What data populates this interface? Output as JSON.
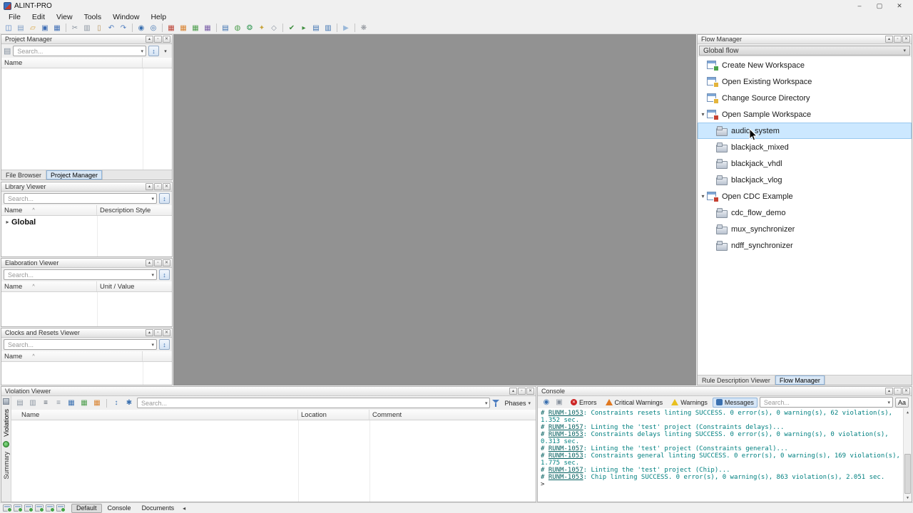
{
  "window": {
    "title": "ALINT-PRO",
    "controls": [
      {
        "name": "minimize-button",
        "glyph": "–"
      },
      {
        "name": "maximize-button",
        "glyph": "▢"
      },
      {
        "name": "close-button",
        "glyph": "✕"
      }
    ]
  },
  "menubar": {
    "items": [
      "File",
      "Edit",
      "View",
      "Tools",
      "Window",
      "Help"
    ]
  },
  "toolbar": {
    "items": [
      {
        "name": "new-workspace-icon",
        "glyph": "◫",
        "color": "#4f7dc0"
      },
      {
        "name": "new-file-icon",
        "glyph": "▤",
        "color": "#7d9cc4"
      },
      {
        "name": "open-icon",
        "glyph": "▱",
        "color": "#d9a33c"
      },
      {
        "name": "save-icon",
        "glyph": "▣",
        "color": "#3f6eb5"
      },
      {
        "name": "save-all-icon",
        "glyph": "▦",
        "color": "#3f6eb5"
      },
      {
        "sep": true
      },
      {
        "name": "cut-icon",
        "glyph": "✂",
        "color": "#8a94a0"
      },
      {
        "name": "copy-icon",
        "glyph": "▥",
        "color": "#8a94a0"
      },
      {
        "name": "paste-icon",
        "glyph": "▯",
        "color": "#b5925a"
      },
      {
        "name": "undo-icon",
        "glyph": "↶",
        "color": "#4f7dc0"
      },
      {
        "name": "redo-icon",
        "glyph": "↷",
        "color": "#4f7dc0"
      },
      {
        "sep": true
      },
      {
        "name": "find-icon",
        "glyph": "◉",
        "color": "#3a70b0"
      },
      {
        "name": "find-in-files-icon",
        "glyph": "◎",
        "color": "#3a70b0"
      },
      {
        "sep": true
      },
      {
        "name": "lint-setup-icon",
        "glyph": "▦",
        "color": "#bb4033"
      },
      {
        "name": "constraints-icon",
        "glyph": "▦",
        "color": "#d9822f"
      },
      {
        "name": "policy-icon",
        "glyph": "▦",
        "color": "#4d9e4d"
      },
      {
        "name": "ruleset-icon",
        "glyph": "▦",
        "color": "#7a5fa8"
      },
      {
        "sep": true
      },
      {
        "name": "report-icon",
        "glyph": "▤",
        "color": "#3a70b0"
      },
      {
        "name": "database-icon",
        "glyph": "◍",
        "color": "#4d9e4d"
      },
      {
        "name": "elaborate-icon",
        "glyph": "❂",
        "color": "#3f9e5f"
      },
      {
        "name": "synthesis-icon",
        "glyph": "✦",
        "color": "#c8a43c"
      },
      {
        "name": "schematic-icon",
        "glyph": "◇",
        "color": "#8a94a0"
      },
      {
        "sep": true
      },
      {
        "name": "check-icon",
        "glyph": "✔",
        "color": "#3f8e3f"
      },
      {
        "name": "run-lint-icon",
        "glyph": "▸",
        "color": "#3f8e3f"
      },
      {
        "name": "run-report-icon",
        "glyph": "▤",
        "color": "#3a70b0"
      },
      {
        "name": "run-all-icon",
        "glyph": "▥",
        "color": "#3a70b0"
      },
      {
        "sep": true
      },
      {
        "name": "play-icon",
        "glyph": "▶",
        "color": "#9ab8d9"
      },
      {
        "sep": true
      },
      {
        "name": "settings-gear-icon",
        "glyph": "❋",
        "color": "#8a8f96"
      }
    ]
  },
  "panel_buttons": [
    {
      "name": "float-panel-button",
      "glyph": "▴"
    },
    {
      "name": "maximize-panel-button",
      "glyph": "▫"
    },
    {
      "name": "close-panel-button",
      "glyph": "✕"
    }
  ],
  "icons": {
    "dropdown": "▾",
    "expander_open": "▾",
    "expander_closed": "▸",
    "sort_indicator": "^",
    "sort": "↕",
    "filter": "▤",
    "scroll_up": "▲",
    "scroll_down": "▼",
    "overflow_left": "◂",
    "error_x": "✕"
  },
  "strings": {
    "search_placeholder": "Search..."
  },
  "colors": {
    "selection": "#cce8ff",
    "selection_border": "#99c9ef",
    "console_teal": "#008080",
    "error_red": "#cc2222",
    "critical_orange": "#e07820",
    "warning_yellow": "#e8c020",
    "message_blue": "#3a70b0",
    "canvas_gray": "#929292"
  },
  "project_manager": {
    "title": "Project Manager",
    "columns": [
      {
        "label": "Name"
      }
    ],
    "tabs": [
      {
        "label": "File Browser"
      },
      {
        "label": "Project Manager",
        "active": true
      }
    ]
  },
  "library_viewer": {
    "title": "Library Viewer",
    "columns": [
      {
        "label": "Name",
        "sorted": true
      },
      {
        "label": "Description Style"
      }
    ],
    "items": [
      {
        "label": "Global"
      }
    ]
  },
  "elaboration_viewer": {
    "title": "Elaboration Viewer",
    "columns": [
      {
        "label": "Name",
        "sorted": true
      },
      {
        "label": "Unit / Value"
      }
    ]
  },
  "clocks_viewer": {
    "title": "Clocks and Resets Viewer",
    "columns": [
      {
        "label": "Name",
        "sorted": true
      }
    ]
  },
  "flow_manager": {
    "title": "Flow Manager",
    "combo_value": "Global flow",
    "items": [
      {
        "label": "Create New Workspace",
        "type": "action",
        "icon": "ws",
        "badge": "green"
      },
      {
        "label": "Open Existing Workspace",
        "type": "action",
        "icon": "ws",
        "badge": "yellow"
      },
      {
        "label": "Change Source Directory",
        "type": "action",
        "icon": "ws",
        "badge": "yellow"
      },
      {
        "label": "Open Sample Workspace",
        "type": "group",
        "expanded": true,
        "icon": "ws",
        "badge": "red"
      },
      {
        "label": "audio_system",
        "type": "child",
        "icon": "proj",
        "selected": true
      },
      {
        "label": "blackjack_mixed",
        "type": "child",
        "icon": "proj"
      },
      {
        "label": "blackjack_vhdl",
        "type": "child",
        "icon": "proj"
      },
      {
        "label": "blackjack_vlog",
        "type": "child",
        "icon": "proj"
      },
      {
        "label": "Open CDC Example",
        "type": "group",
        "expanded": true,
        "icon": "ws",
        "badge": "red"
      },
      {
        "label": "cdc_flow_demo",
        "type": "child",
        "icon": "proj"
      },
      {
        "label": "mux_synchronizer",
        "type": "child",
        "icon": "proj"
      },
      {
        "label": "ndff_synchronizer",
        "type": "child",
        "icon": "proj"
      }
    ],
    "tabs": [
      {
        "label": "Rule Description Viewer"
      },
      {
        "label": "Flow Manager",
        "active": true
      }
    ]
  },
  "violation_viewer": {
    "title": "Violation Viewer",
    "toolbar_icons": [
      {
        "name": "export-icon",
        "glyph": "▤",
        "color": "#8a94a0"
      },
      {
        "name": "copy-icon",
        "glyph": "▥",
        "color": "#8a94a0"
      },
      {
        "name": "expand-all-icon",
        "glyph": "≡",
        "color": "#55606c"
      },
      {
        "name": "collapse-all-icon",
        "glyph": "≡",
        "color": "#8a94a0"
      },
      {
        "name": "group-icon",
        "glyph": "▦",
        "color": "#3a70b0"
      },
      {
        "name": "waive-icon",
        "glyph": "▦",
        "color": "#4d9e4d"
      },
      {
        "name": "severity-icon",
        "glyph": "▦",
        "color": "#d9822f"
      },
      {
        "sep": true
      },
      {
        "name": "sort-icon",
        "glyph": "↕",
        "color": "#3a70b0"
      },
      {
        "name": "filter-config-icon",
        "glyph": "✱",
        "color": "#3a70b0"
      }
    ],
    "phases_label": "Phases",
    "columns": [
      {
        "label": "Name"
      },
      {
        "label": "Location"
      },
      {
        "label": "Comment"
      }
    ],
    "side_tabs": [
      {
        "label": "Violations",
        "icon": "violations",
        "active": true
      },
      {
        "label": "Summary",
        "icon": "summary"
      }
    ]
  },
  "console": {
    "title": "Console",
    "toolbar_icons": [
      {
        "name": "find-output-icon",
        "glyph": "◉",
        "color": "#3a70b0"
      },
      {
        "name": "save-output-icon",
        "glyph": "▣",
        "color": "#8a94a0"
      }
    ],
    "filters": [
      {
        "label": "Errors",
        "icon": "error"
      },
      {
        "label": "Critical Warnings",
        "icon": "critwarn"
      },
      {
        "label": "Warnings",
        "icon": "warn"
      },
      {
        "label": "Messages",
        "icon": "msg",
        "active": true
      }
    ],
    "match_case_label": "Aa",
    "lines": [
      {
        "code": "RUNM-1053",
        "message": "Constraints resets linting SUCCESS. 0 error(s), 0 warning(s), 62 violation(s), 1.352 sec."
      },
      {
        "code": "RUNM-1057",
        "message": "Linting the 'test' project (Constraints delays)..."
      },
      {
        "code": "RUNM-1053",
        "message": "Constraints delays linting SUCCESS. 0 error(s), 0 warning(s), 0 violation(s), 0.313 sec."
      },
      {
        "code": "RUNM-1057",
        "message": "Linting the 'test' project (Constraints general)..."
      },
      {
        "code": "RUNM-1053",
        "message": "Constraints general linting SUCCESS. 0 error(s), 0 warning(s), 169 violation(s), 1.775 sec."
      },
      {
        "code": "RUNM-1057",
        "message": "Linting the 'test' project (Chip)..."
      },
      {
        "code": "RUNM-1053",
        "message": "Chip linting SUCCESS. 0 error(s), 0 warning(s), 863 violation(s), 2.051 sec."
      }
    ],
    "prompt": ">"
  },
  "statusbar": {
    "icons": [
      "dock-console-icon",
      "dock-documents-icon",
      "dock-project-icon",
      "dock-library-icon",
      "dock-flow-icon",
      "dock-violations-icon"
    ],
    "tabs": [
      {
        "label": "Default",
        "active": true
      },
      {
        "label": "Console"
      },
      {
        "label": "Documents"
      }
    ]
  }
}
